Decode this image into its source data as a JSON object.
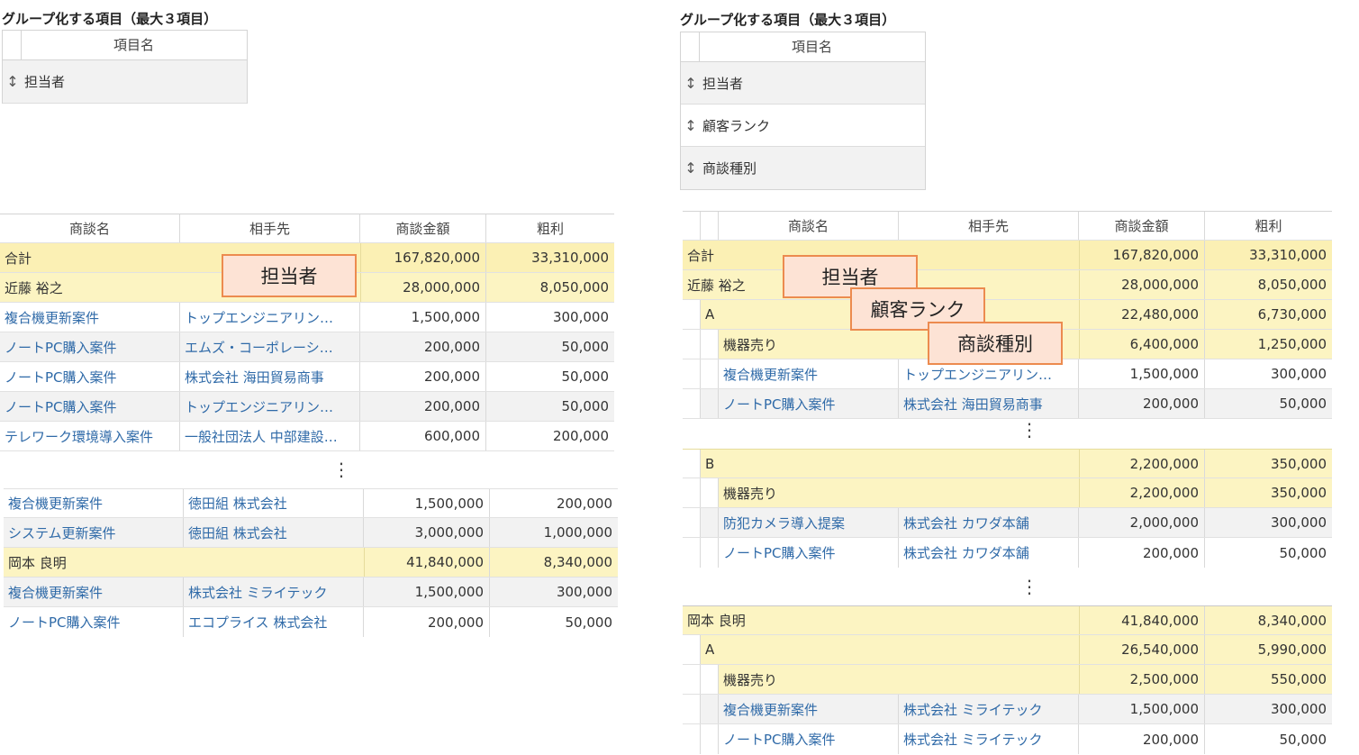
{
  "left": {
    "heading": "グループ化する項目（最大３項目）",
    "config": {
      "column_label": "項目名",
      "handle_glyph": "↕",
      "items": [
        "担当者"
      ]
    },
    "table": {
      "headers": [
        "商談名",
        "相手先",
        "商談金額",
        "粗利"
      ],
      "total": {
        "label": "合計",
        "amount": "167,820,000",
        "profit": "33,310,000"
      },
      "group1": {
        "label": "近藤 裕之",
        "amount": "28,000,000",
        "profit": "8,050,000"
      },
      "rows1": [
        {
          "name": "複合機更新案件",
          "partner": "トップエンジニアリン…",
          "amount": "1,500,000",
          "profit": "300,000"
        },
        {
          "name": "ノートPC購入案件",
          "partner": "エムズ・コーポレーシ…",
          "amount": "200,000",
          "profit": "50,000"
        },
        {
          "name": "ノートPC購入案件",
          "partner": "株式会社 海田貿易商事",
          "amount": "200,000",
          "profit": "50,000"
        },
        {
          "name": "ノートPC購入案件",
          "partner": "トップエンジニアリン…",
          "amount": "200,000",
          "profit": "50,000"
        },
        {
          "name": "テレワーク環境導入案件",
          "partner": "一般社団法人 中部建設…",
          "amount": "600,000",
          "profit": "200,000"
        }
      ],
      "rows2": [
        {
          "name": "複合機更新案件",
          "partner": "徳田組 株式会社",
          "amount": "1,500,000",
          "profit": "200,000"
        },
        {
          "name": "システム更新案件",
          "partner": "徳田組 株式会社",
          "amount": "3,000,000",
          "profit": "1,000,000"
        }
      ],
      "group2": {
        "label": "岡本 良明",
        "amount": "41,840,000",
        "profit": "8,340,000"
      },
      "rows3": [
        {
          "name": "複合機更新案件",
          "partner": "株式会社 ミライテック",
          "amount": "1,500,000",
          "profit": "300,000"
        },
        {
          "name": "ノートPC購入案件",
          "partner": "エコプライス 株式会社",
          "amount": "200,000",
          "profit": "50,000"
        }
      ]
    },
    "callout": "担当者",
    "ellipsis": "⋮"
  },
  "right": {
    "heading": "グループ化する項目（最大３項目）",
    "config": {
      "column_label": "項目名",
      "handle_glyph": "↕",
      "items": [
        "担当者",
        "顧客ランク",
        "商談種別"
      ]
    },
    "table": {
      "headers": [
        "商談名",
        "相手先",
        "商談金額",
        "粗利"
      ],
      "total": {
        "label": "合計",
        "amount": "167,820,000",
        "profit": "33,310,000"
      },
      "g1": {
        "label": "近藤 裕之",
        "amount": "28,000,000",
        "profit": "8,050,000"
      },
      "g1a": {
        "label": "A",
        "amount": "22,480,000",
        "profit": "6,730,000"
      },
      "g1a1": {
        "label": "機器売り",
        "amount": "6,400,000",
        "profit": "1,250,000"
      },
      "rowsA": [
        {
          "name": "複合機更新案件",
          "partner": "トップエンジニアリン…",
          "amount": "1,500,000",
          "profit": "300,000"
        },
        {
          "name": "ノートPC購入案件",
          "partner": "株式会社 海田貿易商事",
          "amount": "200,000",
          "profit": "50,000"
        }
      ],
      "g1b": {
        "label": "B",
        "amount": "2,200,000",
        "profit": "350,000"
      },
      "g1b1": {
        "label": "機器売り",
        "amount": "2,200,000",
        "profit": "350,000"
      },
      "rowsB": [
        {
          "name": "防犯カメラ導入提案",
          "partner": "株式会社 カワダ本舗",
          "amount": "2,000,000",
          "profit": "300,000"
        },
        {
          "name": "ノートPC購入案件",
          "partner": "株式会社 カワダ本舗",
          "amount": "200,000",
          "profit": "50,000"
        }
      ],
      "g2": {
        "label": "岡本 良明",
        "amount": "41,840,000",
        "profit": "8,340,000"
      },
      "g2a": {
        "label": "A",
        "amount": "26,540,000",
        "profit": "5,990,000"
      },
      "g2a1": {
        "label": "機器売り",
        "amount": "2,500,000",
        "profit": "550,000"
      },
      "rowsC": [
        {
          "name": "複合機更新案件",
          "partner": "株式会社 ミライテック",
          "amount": "1,500,000",
          "profit": "300,000"
        },
        {
          "name": "ノートPC購入案件",
          "partner": "株式会社 ミライテック",
          "amount": "200,000",
          "profit": "50,000"
        }
      ]
    },
    "callouts": [
      "担当者",
      "顧客ランク",
      "商談種別"
    ],
    "ellipsis": "⋮"
  },
  "colors": {
    "total_bg": "#fbf0b4",
    "group_bg": "#fcf4c2",
    "link": "#2f6aa8",
    "callout_bg": "#fde3d5",
    "callout_border": "#ec8b4f"
  }
}
